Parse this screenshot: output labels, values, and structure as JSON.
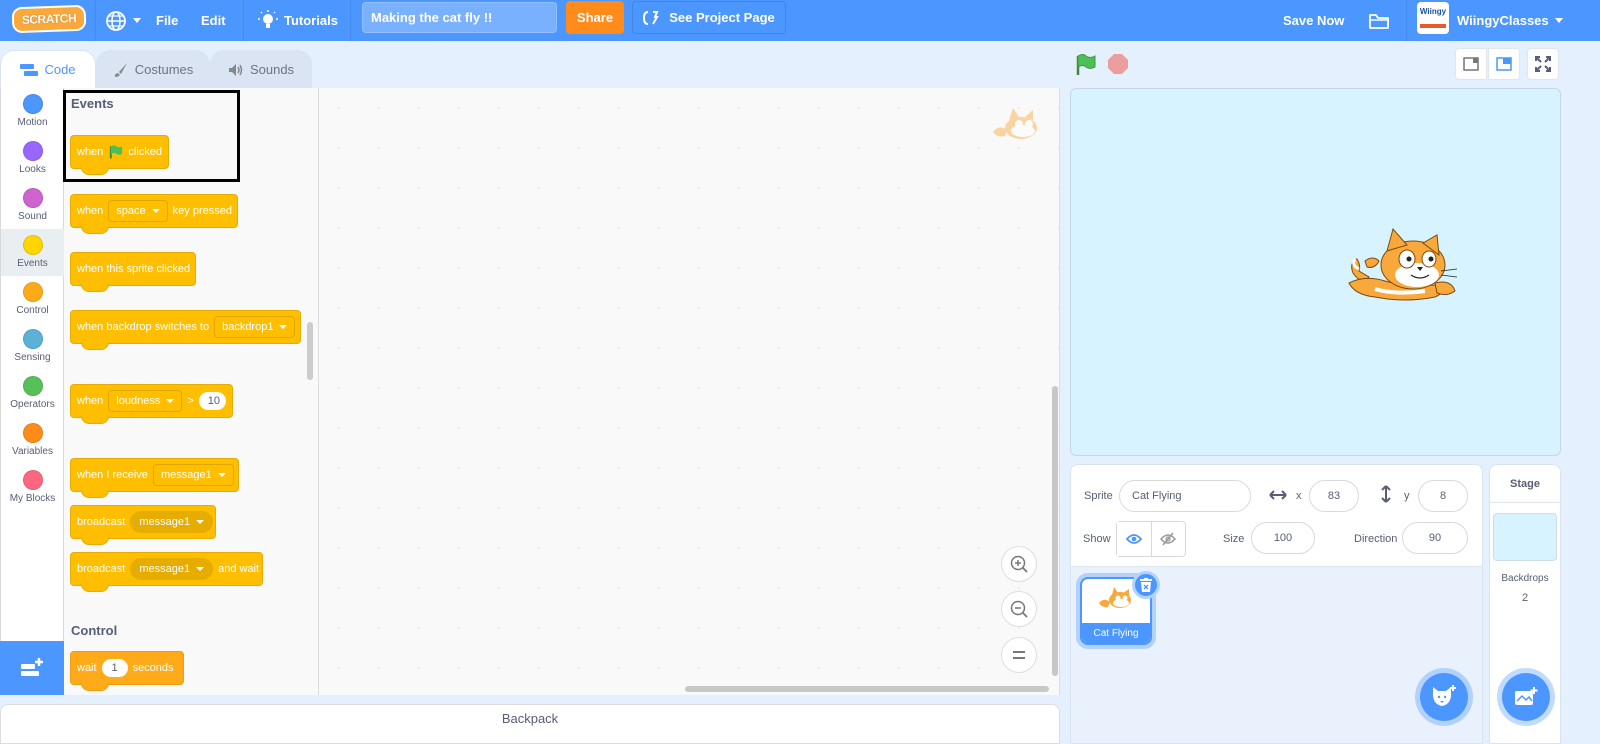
{
  "menubar": {
    "logo": "SCRATCH",
    "language_icon": "globe-icon",
    "file": "File",
    "edit": "Edit",
    "tutorials": "Tutorials",
    "project_title": "Making the cat fly !!",
    "share": "Share",
    "see_project_page": "See Project Page",
    "save_now": "Save Now",
    "folder_icon": "folder-icon",
    "username": "WiingyClasses",
    "avatar_text": "Wiingy"
  },
  "tabs": [
    {
      "label": "Code",
      "icon": "code-icon",
      "active": true
    },
    {
      "label": "Costumes",
      "icon": "brush-icon",
      "active": false
    },
    {
      "label": "Sounds",
      "icon": "speaker-icon",
      "active": false
    }
  ],
  "categories": [
    {
      "label": "Motion",
      "color": "#4c97ff"
    },
    {
      "label": "Looks",
      "color": "#9966ff"
    },
    {
      "label": "Sound",
      "color": "#cf63cf"
    },
    {
      "label": "Events",
      "color": "#ffd500",
      "selected": true
    },
    {
      "label": "Control",
      "color": "#ffab19"
    },
    {
      "label": "Sensing",
      "color": "#5cb1d6"
    },
    {
      "label": "Operators",
      "color": "#59c059"
    },
    {
      "label": "Variables",
      "color": "#ff8c1a"
    },
    {
      "label": "My Blocks",
      "color": "#ff6680"
    }
  ],
  "palette": {
    "events_title": "Events",
    "control_title": "Control",
    "blocks": {
      "flag_clicked": {
        "pre": "when",
        "post": "clicked"
      },
      "key_pressed": {
        "pre": "when",
        "dropdown": "space",
        "post": "key pressed"
      },
      "sprite_clicked": {
        "text": "when this sprite clicked"
      },
      "backdrop_switch": {
        "pre": "when backdrop switches to",
        "dropdown": "backdrop1"
      },
      "loudness": {
        "pre": "when",
        "dropdown": "loudness",
        "op": ">",
        "value": "10"
      },
      "receive": {
        "pre": "when I receive",
        "dropdown": "message1"
      },
      "broadcast": {
        "pre": "broadcast",
        "dropdown": "message1"
      },
      "broadcast_wait": {
        "pre": "broadcast",
        "dropdown": "message1",
        "post": "and wait"
      },
      "wait": {
        "pre": "wait",
        "value": "1",
        "post": "seconds"
      }
    }
  },
  "workspace": {
    "zoom_in": "zoom-in-icon",
    "zoom_out": "zoom-out-icon",
    "zoom_reset": "zoom-reset-icon"
  },
  "backpack": "Backpack",
  "sprite_info": {
    "sprite_label": "Sprite",
    "sprite_name": "Cat Flying",
    "x_label": "x",
    "x": "83",
    "y_label": "y",
    "y": "8",
    "show_label": "Show",
    "size_label": "Size",
    "size": "100",
    "direction_label": "Direction",
    "direction": "90"
  },
  "sprites": [
    {
      "name": "Cat Flying",
      "selected": true
    }
  ],
  "stage_panel": {
    "title": "Stage",
    "backdrops_label": "Backdrops",
    "backdrops_count": "2"
  }
}
